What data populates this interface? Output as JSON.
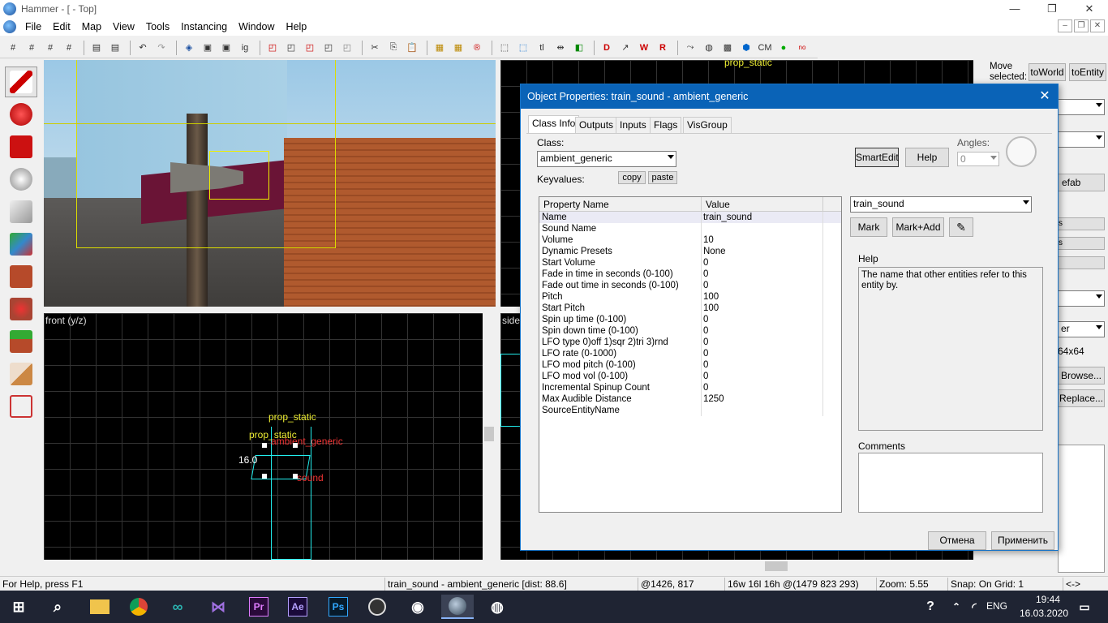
{
  "window": {
    "title": "Hammer - [ - Top]",
    "minimize": "—",
    "restore": "❐",
    "close": "✕"
  },
  "menu": [
    "File",
    "Edit",
    "Map",
    "View",
    "Tools",
    "Instancing",
    "Window",
    "Help"
  ],
  "mdi": [
    "–",
    "❐",
    "✕"
  ],
  "toolbar": {
    "labels": [
      "tl",
      "CM"
    ]
  },
  "viewports": {
    "front_label": "front (y/z)",
    "side_label": "side",
    "top_label": "prop_static",
    "front_annotations": {
      "prop1": "prop_static",
      "prop2": "prop_static",
      "ambient": "ambient_generic",
      "dim": "16.0",
      "sound": "sound"
    }
  },
  "right_panel": {
    "move_label": "Move selected:",
    "to_world": "toWorld",
    "to_entity": "toEntity",
    "prefab": "efab",
    "s1": "s",
    "s2": "s",
    "er": "er",
    "tex_size": "64x64",
    "browse": "Browse...",
    "replace": "Replace..."
  },
  "dialog": {
    "title": "Object Properties: train_sound - ambient_generic",
    "close": "✕",
    "tabs": [
      "Class Info",
      "Outputs",
      "Inputs",
      "Flags",
      "VisGroup"
    ],
    "class_label": "Class:",
    "class_value": "ambient_generic",
    "keyvalues_label": "Keyvalues:",
    "copy": "copy",
    "paste": "paste",
    "smartedit": "SmartEdit",
    "help_btn": "Help",
    "angles_label": "Angles:",
    "angles_value": "0",
    "col_name": "Property Name",
    "col_value": "Value",
    "properties": [
      {
        "name": "Name",
        "value": "train_sound"
      },
      {
        "name": "Sound Name",
        "value": ""
      },
      {
        "name": "Volume",
        "value": "10"
      },
      {
        "name": "Dynamic Presets",
        "value": "None"
      },
      {
        "name": "Start Volume",
        "value": "0"
      },
      {
        "name": "Fade in time in seconds (0-100)",
        "value": "0"
      },
      {
        "name": "Fade out time in seconds (0-100)",
        "value": "0"
      },
      {
        "name": "Pitch",
        "value": "100"
      },
      {
        "name": "Start Pitch",
        "value": "100"
      },
      {
        "name": "Spin up time (0-100)",
        "value": "0"
      },
      {
        "name": "Spin down time (0-100)",
        "value": "0"
      },
      {
        "name": "LFO type 0)off 1)sqr 2)tri 3)rnd",
        "value": "0"
      },
      {
        "name": "LFO rate (0-1000)",
        "value": "0"
      },
      {
        "name": "LFO mod pitch (0-100)",
        "value": "0"
      },
      {
        "name": "LFO mod vol (0-100)",
        "value": "0"
      },
      {
        "name": "Incremental Spinup Count",
        "value": "0"
      },
      {
        "name": "Max Audible Distance",
        "value": "1250"
      },
      {
        "name": "SourceEntityName",
        "value": ""
      }
    ],
    "edit_value": "train_sound",
    "mark": "Mark",
    "mark_add": "Mark+Add",
    "help_label": "Help",
    "help_text": "The name that other entities refer to this entity by.",
    "comments_label": "Comments",
    "cancel": "Отмена",
    "apply": "Применить"
  },
  "status": {
    "help": "For Help, press F1",
    "selection": "train_sound - ambient_generic  [dist: 88.6]",
    "coords": "@1426, 817",
    "size": "16w 16l 16h @(1479 823 293)",
    "zoom": "Zoom: 5.55",
    "snap": "Snap: On Grid: 1",
    "arrows": "<->"
  },
  "taskbar": {
    "lang": "ENG",
    "time": "19:44",
    "date": "16.03.2020",
    "apps": [
      "Pr",
      "Ae",
      "Ps"
    ]
  }
}
